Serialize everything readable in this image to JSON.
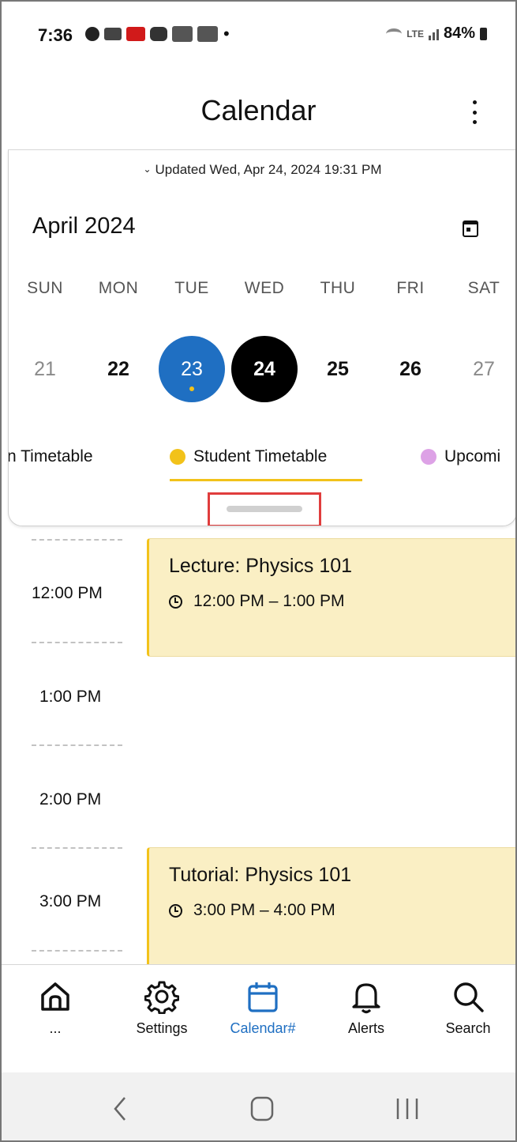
{
  "status_bar": {
    "time": "7:36",
    "battery": "84%",
    "network_label": "LTE"
  },
  "header": {
    "title": "Calendar"
  },
  "calendar": {
    "updated_text": "Updated Wed, Apr 24, 2024 19:31 PM",
    "month_label": "April 2024",
    "weekdays": [
      "SUN",
      "MON",
      "TUE",
      "WED",
      "THU",
      "FRI",
      "SAT"
    ],
    "dates": [
      "21",
      "22",
      "23",
      "24",
      "25",
      "26",
      "27"
    ],
    "selected_date": "23",
    "today_date": "24",
    "tabs": [
      {
        "label": "n Timetable",
        "dot_color": ""
      },
      {
        "label": "Student Timetable",
        "dot_color": "#f2c21a"
      },
      {
        "label": "Upcomi",
        "dot_color": "#dda2e6"
      }
    ],
    "active_tab": "Student Timetable"
  },
  "timeline": {
    "slots": [
      "12:00 PM",
      "1:00 PM",
      "2:00 PM",
      "3:00 PM"
    ],
    "events": [
      {
        "type": "Lecture:",
        "title": "Physics 101",
        "time": "12:00 PM – 1:00 PM"
      },
      {
        "type": "Tutorial:",
        "title": "Physics 101",
        "time": "3:00 PM – 4:00 PM"
      }
    ]
  },
  "bottom_nav": {
    "items": [
      {
        "label": "...",
        "icon": "home-icon"
      },
      {
        "label": "Settings",
        "icon": "gear-icon"
      },
      {
        "label": "Calendar#",
        "icon": "calendar-icon",
        "active": true
      },
      {
        "label": "Alerts",
        "icon": "bell-icon"
      },
      {
        "label": "Search",
        "icon": "search-icon"
      }
    ]
  },
  "colors": {
    "accent_blue": "#1f6fc2",
    "event_yellow": "#faefc4",
    "tab_yellow": "#f2c21a"
  }
}
